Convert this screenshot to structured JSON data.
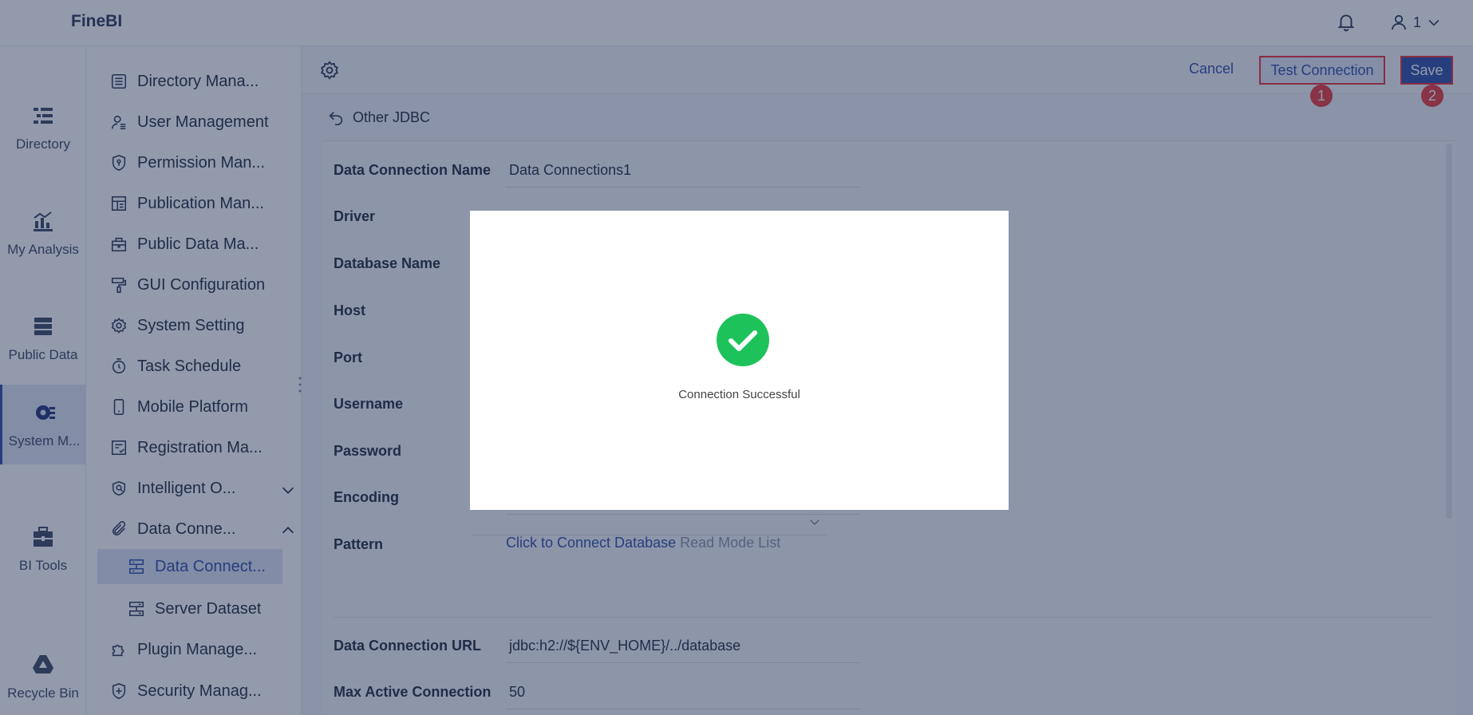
{
  "app": {
    "title": "FineBI"
  },
  "header": {
    "user_label": "1",
    "icons": [
      "bell-icon",
      "user-icon",
      "chevron-down-icon"
    ]
  },
  "left_nav": [
    {
      "label": "Directory",
      "icon": "directory-icon"
    },
    {
      "label": "My Analysis",
      "icon": "analysis-icon"
    },
    {
      "label": "Public Data",
      "icon": "public-data-icon"
    },
    {
      "label": "System M...",
      "icon": "system-management-icon",
      "active": true
    },
    {
      "label": "BI Tools",
      "icon": "toolbox-icon"
    },
    {
      "label": "Recycle Bin",
      "icon": "recycle-bin-icon"
    }
  ],
  "sub_nav": [
    {
      "label": "Directory Mana...",
      "icon": "directory-list-icon"
    },
    {
      "label": "User Management",
      "icon": "user-management-icon"
    },
    {
      "label": "Permission Man...",
      "icon": "permission-shield-icon"
    },
    {
      "label": "Publication Man...",
      "icon": "publication-icon"
    },
    {
      "label": "Public Data Ma...",
      "icon": "public-data-manage-icon"
    },
    {
      "label": "GUI Configuration",
      "icon": "paint-roller-icon"
    },
    {
      "label": "System Setting",
      "icon": "gear-icon"
    },
    {
      "label": "Task Schedule",
      "icon": "timer-icon"
    },
    {
      "label": "Mobile Platform",
      "icon": "mobile-icon"
    },
    {
      "label": "Registration Ma...",
      "icon": "registration-icon"
    },
    {
      "label": "Intelligent O...",
      "icon": "intelligent-ops-icon"
    },
    {
      "label": "Data Conne...",
      "icon": "paperclip-icon"
    },
    {
      "label": "Data Connect...",
      "icon": "data-connection-icon",
      "selected": true
    },
    {
      "label": "Server Dataset",
      "icon": "server-dataset-icon"
    },
    {
      "label": "Plugin Manage...",
      "icon": "puzzle-icon"
    },
    {
      "label": "Security Manag...",
      "icon": "security-shield-icon"
    }
  ],
  "toolbar": {
    "cancel": "Cancel",
    "test_connection": "Test Connection",
    "save": "Save",
    "badge_1": "1",
    "badge_2": "2"
  },
  "breadcrumb": {
    "back_label": "Other JDBC"
  },
  "form": {
    "fields": [
      {
        "label": "Data Connection Name",
        "value": "Data Connections1"
      },
      {
        "label": "Driver",
        "value": ""
      },
      {
        "label": "Database Name",
        "value": ""
      },
      {
        "label": "Host",
        "value": ""
      },
      {
        "label": "Port",
        "value": ""
      },
      {
        "label": "Username",
        "value": ""
      },
      {
        "label": "Password",
        "value": ""
      },
      {
        "label": "Encoding",
        "value": ""
      },
      {
        "label": "Pattern",
        "value": ""
      },
      {
        "label": "Data Connection URL",
        "value": "jdbc:h2://${ENV_HOME}/../database"
      },
      {
        "label": "Max Active Connection",
        "value": "50"
      }
    ],
    "pattern_link": "Click to Connect Database",
    "pattern_hint": "Read Mode List"
  },
  "dialog": {
    "message": "Connection Successful",
    "icon": "check-circle-icon",
    "color": "#1ec25a"
  },
  "colors": {
    "accent": "#2e4fa8",
    "highlight": "#e8313a",
    "success": "#1ec25a"
  }
}
